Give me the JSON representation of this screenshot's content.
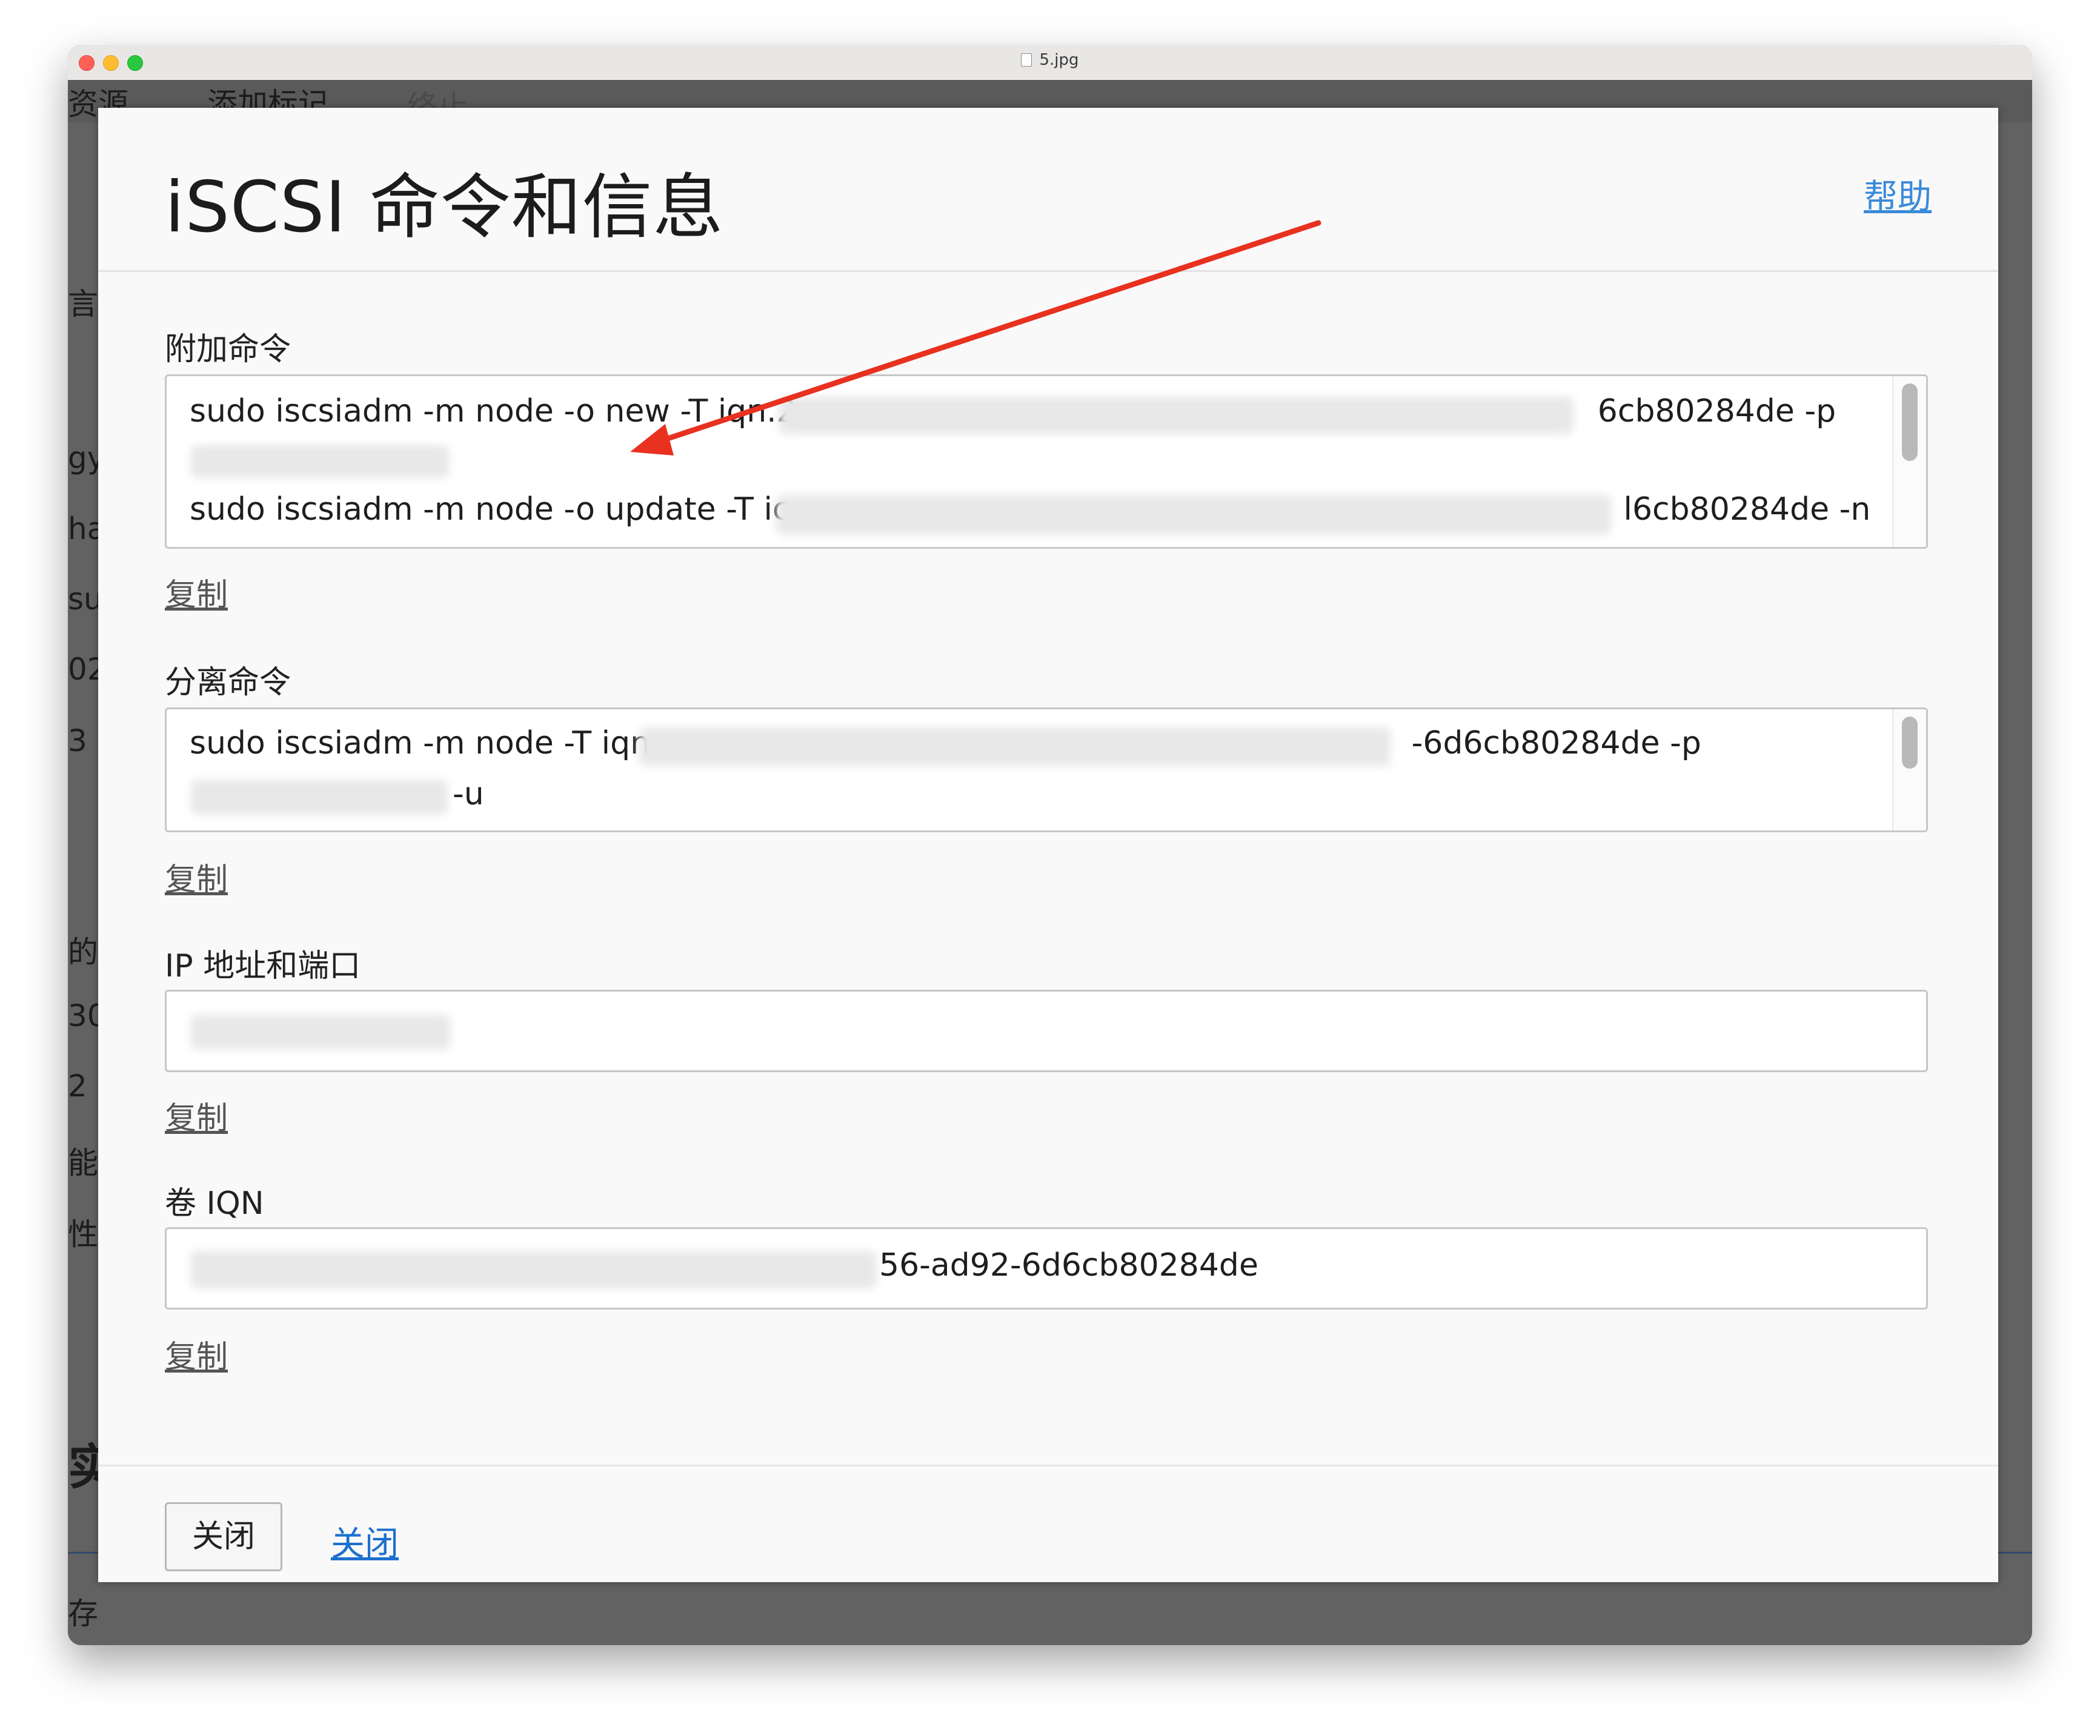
{
  "window": {
    "filename": "5.jpg"
  },
  "background_app": {
    "tabs": [
      "资源",
      "添加标记",
      "终止"
    ],
    "side_fragments": [
      "言",
      "gy",
      "ha",
      "su",
      "02",
      "3",
      "的",
      "30",
      "2",
      "能",
      "性",
      "实",
      "存"
    ]
  },
  "dialog": {
    "title": "iSCSI 命令和信息",
    "help_label": "帮助",
    "attach": {
      "label": "附加命令",
      "line1_prefix": "sudo iscsiadm -m node -o new -T iqn.2",
      "line1_suffix": "6cb80284de -p",
      "line3_prefix": "sudo iscsiadm -m node -o update -T ic",
      "line3_suffix": "l6cb80284de -n",
      "copy_label": "复制"
    },
    "detach": {
      "label": "分离命令",
      "line1_prefix": "sudo iscsiadm -m node -T iqn.",
      "line1_suffix": "-6d6cb80284de -p",
      "line2_suffix": "-u",
      "copy_label": "复制"
    },
    "ip_port": {
      "label": "IP 地址和端口",
      "copy_label": "复制"
    },
    "volume_iqn": {
      "label": "卷 IQN",
      "value_suffix": "56-ad92-6d6cb80284de",
      "copy_label": "复制"
    },
    "footer": {
      "close_button_label": "关闭",
      "close_link_label": "关闭"
    }
  },
  "colors": {
    "link_blue": "#1c6fce",
    "help_blue": "#3a8ad9",
    "annotation_arrow": "#e8311f"
  }
}
